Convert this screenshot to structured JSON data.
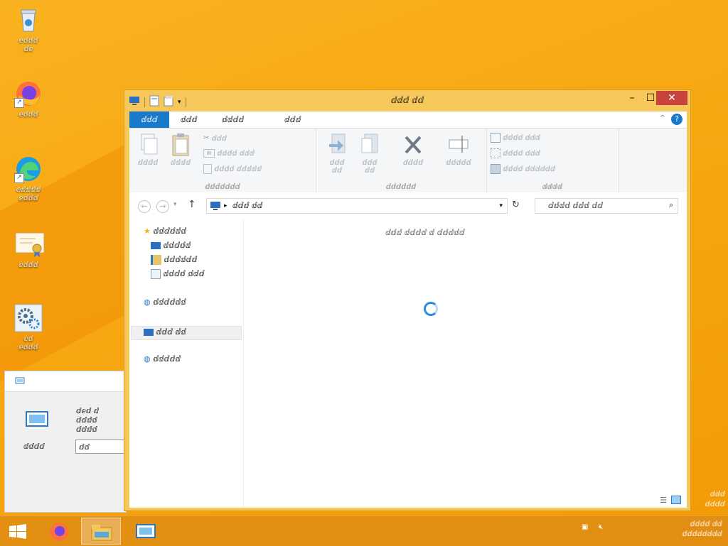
{
  "desktop": {
    "icons": [
      {
        "name": "recycle-bin",
        "label": "ⅇⅆⅆⅆ\nⅆⅇ",
        "icon": "recycle-bin-icon"
      },
      {
        "name": "firefox",
        "label": "ⅇⅆⅆⅆ",
        "icon": "firefox-icon"
      },
      {
        "name": "edge",
        "label": "ⅇⅆⅆⅆⅆ\nⅇⅆⅆⅆ",
        "icon": "edge-icon"
      },
      {
        "name": "certificate",
        "label": "ⅇⅆⅆⅆ",
        "icon": "certificate-icon"
      },
      {
        "name": "settings",
        "label": "ⅇⅆ\nⅇⅆⅆⅆ",
        "icon": "gears-icon"
      }
    ]
  },
  "dialog": {
    "title": "ⅆⅇⅆ ⅆ\nⅆⅆⅆⅆ\nⅆⅆⅆⅆ",
    "open_label": "ⅆⅆⅆⅆ",
    "open_value": "ⅆⅆ"
  },
  "explorer": {
    "title": "ⅆⅆⅆ ⅆⅆ",
    "tabs": [
      "ⅆⅆⅆ",
      "ⅆⅆⅆ",
      "ⅆⅆⅆⅆ",
      "ⅆⅆⅆ"
    ],
    "ribbon": {
      "clipboard": {
        "copy": "ⅆⅆⅆⅆ",
        "paste": "ⅆⅆⅆⅆ",
        "cut": "ⅆⅆⅆ",
        "copy_path": "ⅆⅆⅆⅆ ⅆⅆⅆ",
        "paste_shortcut": "ⅆⅆⅆⅆ ⅆⅆⅆⅆⅆ",
        "group": "ⅆⅆⅆⅆⅆⅆⅆ"
      },
      "organize": {
        "move_to": "ⅆⅆⅆ\nⅆⅆ",
        "copy_to": "ⅆⅆⅆ\nⅆⅆ",
        "delete": "ⅆⅆⅆⅆ",
        "rename": "ⅆⅆⅆⅆⅆ",
        "group": "ⅆⅆⅆⅆⅆⅆ"
      },
      "select": {
        "select_all": "ⅆⅆⅆⅆ ⅆⅆⅆ",
        "select_none": "ⅆⅆⅆⅆ ⅆⅆⅆ",
        "invert": "ⅆⅆⅆⅆ ⅆⅆⅆⅆⅆⅆ",
        "group": "ⅆⅆⅆⅆ"
      }
    },
    "address": "ⅆⅆⅆ ⅆⅆ",
    "search_placeholder": "ⅆⅆⅆⅆ ⅆⅆⅆ ⅆⅆ",
    "nav": {
      "quick_access": "ⅆⅆⅆⅆⅆⅆ",
      "desktop": "ⅆⅆⅆⅆⅆ",
      "downloads": "ⅆⅆⅆⅆⅆⅆ",
      "recent": "ⅆⅆⅆⅆ ⅆⅆⅆ",
      "homegroup": "ⅆⅆⅆⅆⅆⅆ",
      "this_pc": "ⅆⅆⅆ ⅆⅆ",
      "network": "ⅆⅆⅆⅆⅆ"
    },
    "empty_message": "ⅆⅆⅆ ⅆⅆⅆⅆ ⅆ ⅆⅆⅆⅆⅆ"
  },
  "taskbar": {
    "clock_time": "ⅆⅆⅆⅆ ⅆⅆ",
    "clock_date": "ⅆⅆⅆⅆⅆⅆⅆⅆ"
  },
  "corner_text": "ⅆⅆⅆ\nⅆⅆⅆⅆ"
}
